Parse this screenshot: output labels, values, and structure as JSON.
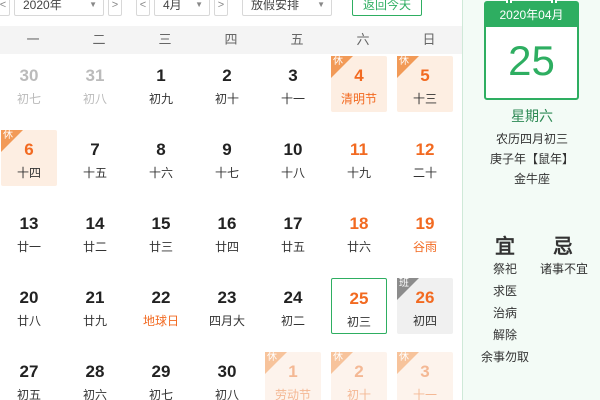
{
  "toolbar": {
    "prev_arrow": "<",
    "next_arrow": ">",
    "year": "2020年",
    "month": "4月",
    "holiday": "放假安排",
    "today_button": "返回今天"
  },
  "weekdays": [
    "一",
    "二",
    "三",
    "四",
    "五",
    "六",
    "日"
  ],
  "badges": {
    "rest": "休",
    "work": "班"
  },
  "weeks": [
    [
      {
        "day": "30",
        "lunar": "初七",
        "kind": "other"
      },
      {
        "day": "31",
        "lunar": "初八",
        "kind": "other"
      },
      {
        "day": "1",
        "lunar": "初九",
        "kind": "normal"
      },
      {
        "day": "2",
        "lunar": "初十",
        "kind": "normal"
      },
      {
        "day": "3",
        "lunar": "十一",
        "kind": "normal"
      },
      {
        "day": "4",
        "lunar": "清明节",
        "kind": "rest",
        "fest": true
      },
      {
        "day": "5",
        "lunar": "十三",
        "kind": "rest"
      }
    ],
    [
      {
        "day": "6",
        "lunar": "十四",
        "kind": "rest"
      },
      {
        "day": "7",
        "lunar": "十五",
        "kind": "normal"
      },
      {
        "day": "8",
        "lunar": "十六",
        "kind": "normal"
      },
      {
        "day": "9",
        "lunar": "十七",
        "kind": "normal"
      },
      {
        "day": "10",
        "lunar": "十八",
        "kind": "normal"
      },
      {
        "day": "11",
        "lunar": "十九",
        "kind": "weekend"
      },
      {
        "day": "12",
        "lunar": "二十",
        "kind": "weekend"
      }
    ],
    [
      {
        "day": "13",
        "lunar": "廿一",
        "kind": "normal"
      },
      {
        "day": "14",
        "lunar": "廿二",
        "kind": "normal"
      },
      {
        "day": "15",
        "lunar": "廿三",
        "kind": "normal"
      },
      {
        "day": "16",
        "lunar": "廿四",
        "kind": "normal"
      },
      {
        "day": "17",
        "lunar": "廿五",
        "kind": "normal"
      },
      {
        "day": "18",
        "lunar": "廿六",
        "kind": "weekend"
      },
      {
        "day": "19",
        "lunar": "谷雨",
        "kind": "weekend",
        "fest": true
      }
    ],
    [
      {
        "day": "20",
        "lunar": "廿八",
        "kind": "normal"
      },
      {
        "day": "21",
        "lunar": "廿九",
        "kind": "normal"
      },
      {
        "day": "22",
        "lunar": "地球日",
        "kind": "normal",
        "fest": true
      },
      {
        "day": "23",
        "lunar": "四月大",
        "kind": "normal"
      },
      {
        "day": "24",
        "lunar": "初二",
        "kind": "normal"
      },
      {
        "day": "25",
        "lunar": "初三",
        "kind": "selected"
      },
      {
        "day": "26",
        "lunar": "初四",
        "kind": "work"
      }
    ],
    [
      {
        "day": "27",
        "lunar": "初五",
        "kind": "normal"
      },
      {
        "day": "28",
        "lunar": "初六",
        "kind": "normal"
      },
      {
        "day": "29",
        "lunar": "初七",
        "kind": "normal"
      },
      {
        "day": "30",
        "lunar": "初八",
        "kind": "normal"
      },
      {
        "day": "1",
        "lunar": "劳动节",
        "kind": "other-rest"
      },
      {
        "day": "2",
        "lunar": "初十",
        "kind": "other-rest"
      },
      {
        "day": "3",
        "lunar": "十一",
        "kind": "other-rest"
      }
    ]
  ],
  "side": {
    "header": "2020年04月",
    "day": "25",
    "weekday": "星期六",
    "lunar_date": "农历四月初三",
    "ganzhi": "庚子年【鼠年】",
    "constellation": "金牛座",
    "yi_title": "宜",
    "ji_title": "忌",
    "yi": [
      "祭祀",
      "求医",
      "治病",
      "解除",
      "余事勿取"
    ],
    "ji": [
      "诸事不宜"
    ]
  },
  "colors": {
    "accent_green": "#2eae61",
    "holiday_orange": "#f26a21",
    "rest_bg": "#fdeee2"
  }
}
